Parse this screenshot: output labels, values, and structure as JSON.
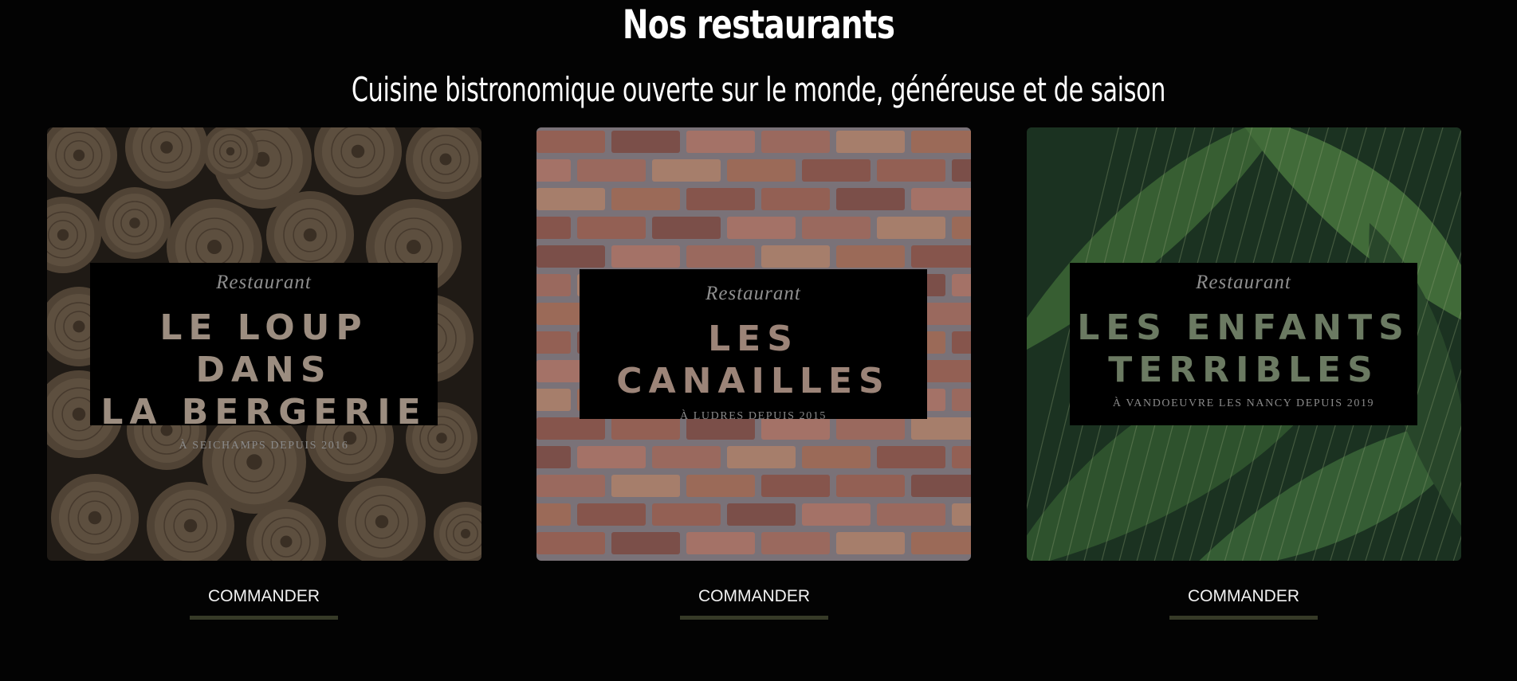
{
  "header": {
    "title": "Nos restaurants",
    "subtitle": "Cuisine bistronomique ouverte sur le monde, généreuse et de saison"
  },
  "restaurants": [
    {
      "kicker": "Restaurant",
      "name_line1": "LE LOUP DANS",
      "name_line2": "LA BERGERIE",
      "since": "À SEICHAMPS DEPUIS 2016",
      "order_label": "COMMANDER",
      "background": "logs-texture",
      "name_color": "#9c8d80"
    },
    {
      "kicker": "Restaurant",
      "name_line1": "LES CANAILLES",
      "name_line2": "",
      "since": "À LUDRES DEPUIS 2015",
      "order_label": "COMMANDER",
      "background": "brick-wall-texture",
      "name_color": "#9c8478"
    },
    {
      "kicker": "Restaurant",
      "name_line1": "LES ENFANTS",
      "name_line2": "TERRIBLES",
      "since": "À VANDOEUVRE LES NANCY DEPUIS 2019",
      "order_label": "COMMANDER",
      "background": "tropical-leaves-texture",
      "name_color": "#6b7a62"
    }
  ],
  "colors": {
    "background": "#030303",
    "accent_underline": "#363a27",
    "kicker": "#8f8f8f",
    "since": "#8a8a8a"
  }
}
